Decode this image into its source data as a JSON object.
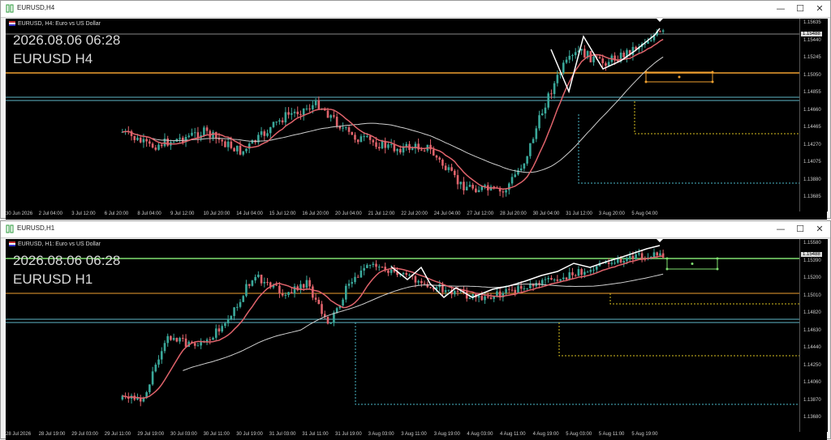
{
  "windows": [
    {
      "id": "h4",
      "title": "EURUSD,H4",
      "header": "EURUSD, H4: Euro vs US Dollar",
      "overlay_date": "2026.08.06 06:28",
      "overlay_symbol": "EURUSD H4",
      "price_labels": [
        "1.15635",
        "1.15440",
        "1.15245",
        "1.15050",
        "1.14855",
        "1.14660",
        "1.14465",
        "1.14270",
        "1.14075",
        "1.13880",
        "1.13685"
      ],
      "current_price": "1.15488",
      "time_labels": [
        "30 Jun 2026",
        "2 Jul 04:00",
        "3 Jul 12:00",
        "6 Jul 20:00",
        "8 Jul 04:00",
        "9 Jul 12:00",
        "10 Jul 20:00",
        "14 Jul 04:00",
        "15 Jul 12:00",
        "16 Jul 20:00",
        "20 Jul 04:00",
        "21 Jul 12:00",
        "22 Jul 20:00",
        "24 Jul 04:00",
        "27 Jul 12:00",
        "28 Jul 20:00",
        "30 Jul 04:00",
        "31 Jul 12:00",
        "3 Aug 20:00",
        "5 Aug 04:00"
      ]
    },
    {
      "id": "h1",
      "title": "EURUSD,H1",
      "header": "EURUSD, H1: Euro vs US Dollar",
      "overlay_date": "2026.08.06 06:28",
      "overlay_symbol": "EURUSD H1",
      "price_labels": [
        "1.15580",
        "1.15390",
        "1.15200",
        "1.15010",
        "1.14820",
        "1.14630",
        "1.14440",
        "1.14250",
        "1.14060",
        "1.13870",
        "1.13680"
      ],
      "current_price": "1.15488",
      "time_labels": [
        "28 Jul 2026",
        "28 Jul 19:00",
        "29 Jul 03:00",
        "29 Jul 11:00",
        "29 Jul 19:00",
        "30 Jul 03:00",
        "30 Jul 11:00",
        "30 Jul 19:00",
        "31 Jul 03:00",
        "31 Jul 11:00",
        "31 Jul 19:00",
        "3 Aug 03:00",
        "3 Aug 11:00",
        "3 Aug 19:00",
        "4 Aug 03:00",
        "4 Aug 11:00",
        "4 Aug 19:00",
        "5 Aug 03:00",
        "5 Aug 11:00",
        "5 Aug 19:00"
      ]
    }
  ],
  "window_buttons": {
    "minimize": "—",
    "maximize": "☐",
    "close": "✕"
  },
  "colors": {
    "bull": "#3aa89a",
    "bear": "#e0636b",
    "ma_fast": "#e0636b",
    "ma_slow": "#cfcfcf",
    "hline_orange": "#f0a030",
    "hline_teal": "#5fb8c8",
    "hline_green": "#7fe070",
    "zigzag": "#ffffff",
    "dotted_cyan": "#4ab7c8",
    "dotted_yellow": "#d8c020"
  }
}
